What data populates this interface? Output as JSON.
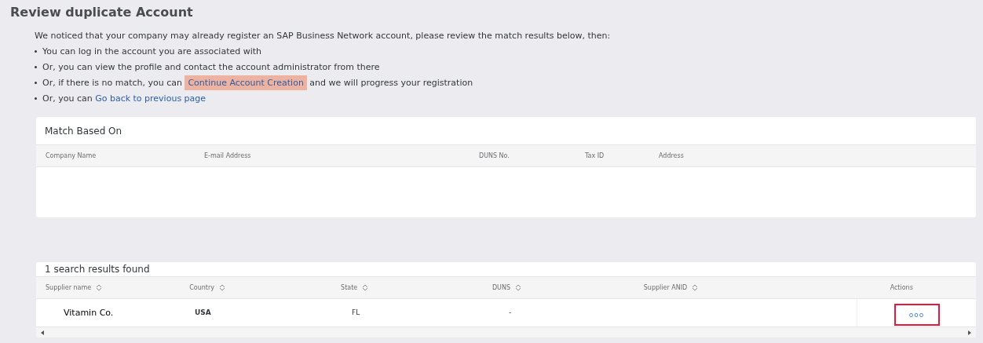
{
  "title": "Review duplicate Account",
  "intro": "We noticed that your company may already register an SAP Business Network account, please review the match results below, then:",
  "bullets": [
    {
      "before": "You can log in the account you are associated with"
    },
    {
      "before": "Or, you can view the profile and contact the account administrator from there"
    },
    {
      "before": "Or, if there is no match, you can",
      "link": "Continue Account Creation",
      "highlighted": true,
      "after": "and we will progress your registration"
    },
    {
      "before": "Or, you can",
      "link": "Go back to previous page",
      "highlighted": false
    }
  ],
  "match_panel": {
    "title": "Match Based On",
    "columns": [
      "Company Name",
      "E-mail Address",
      "DUNS No.",
      "Tax ID",
      "Address"
    ]
  },
  "results_panel": {
    "title": "1 search results found",
    "columns": [
      {
        "label": "Supplier name",
        "sortable": true
      },
      {
        "label": "Country",
        "sortable": true
      },
      {
        "label": "State",
        "sortable": true
      },
      {
        "label": "DUNS",
        "sortable": true
      },
      {
        "label": "Supplier ANID",
        "sortable": true
      },
      {
        "label": "Actions",
        "sortable": false
      }
    ],
    "rows": [
      {
        "supplier_name": "Vitamin Co.",
        "country": "USA",
        "state": "FL",
        "duns": "-",
        "actions": "ooo",
        "actions_highlighted": true
      }
    ]
  }
}
